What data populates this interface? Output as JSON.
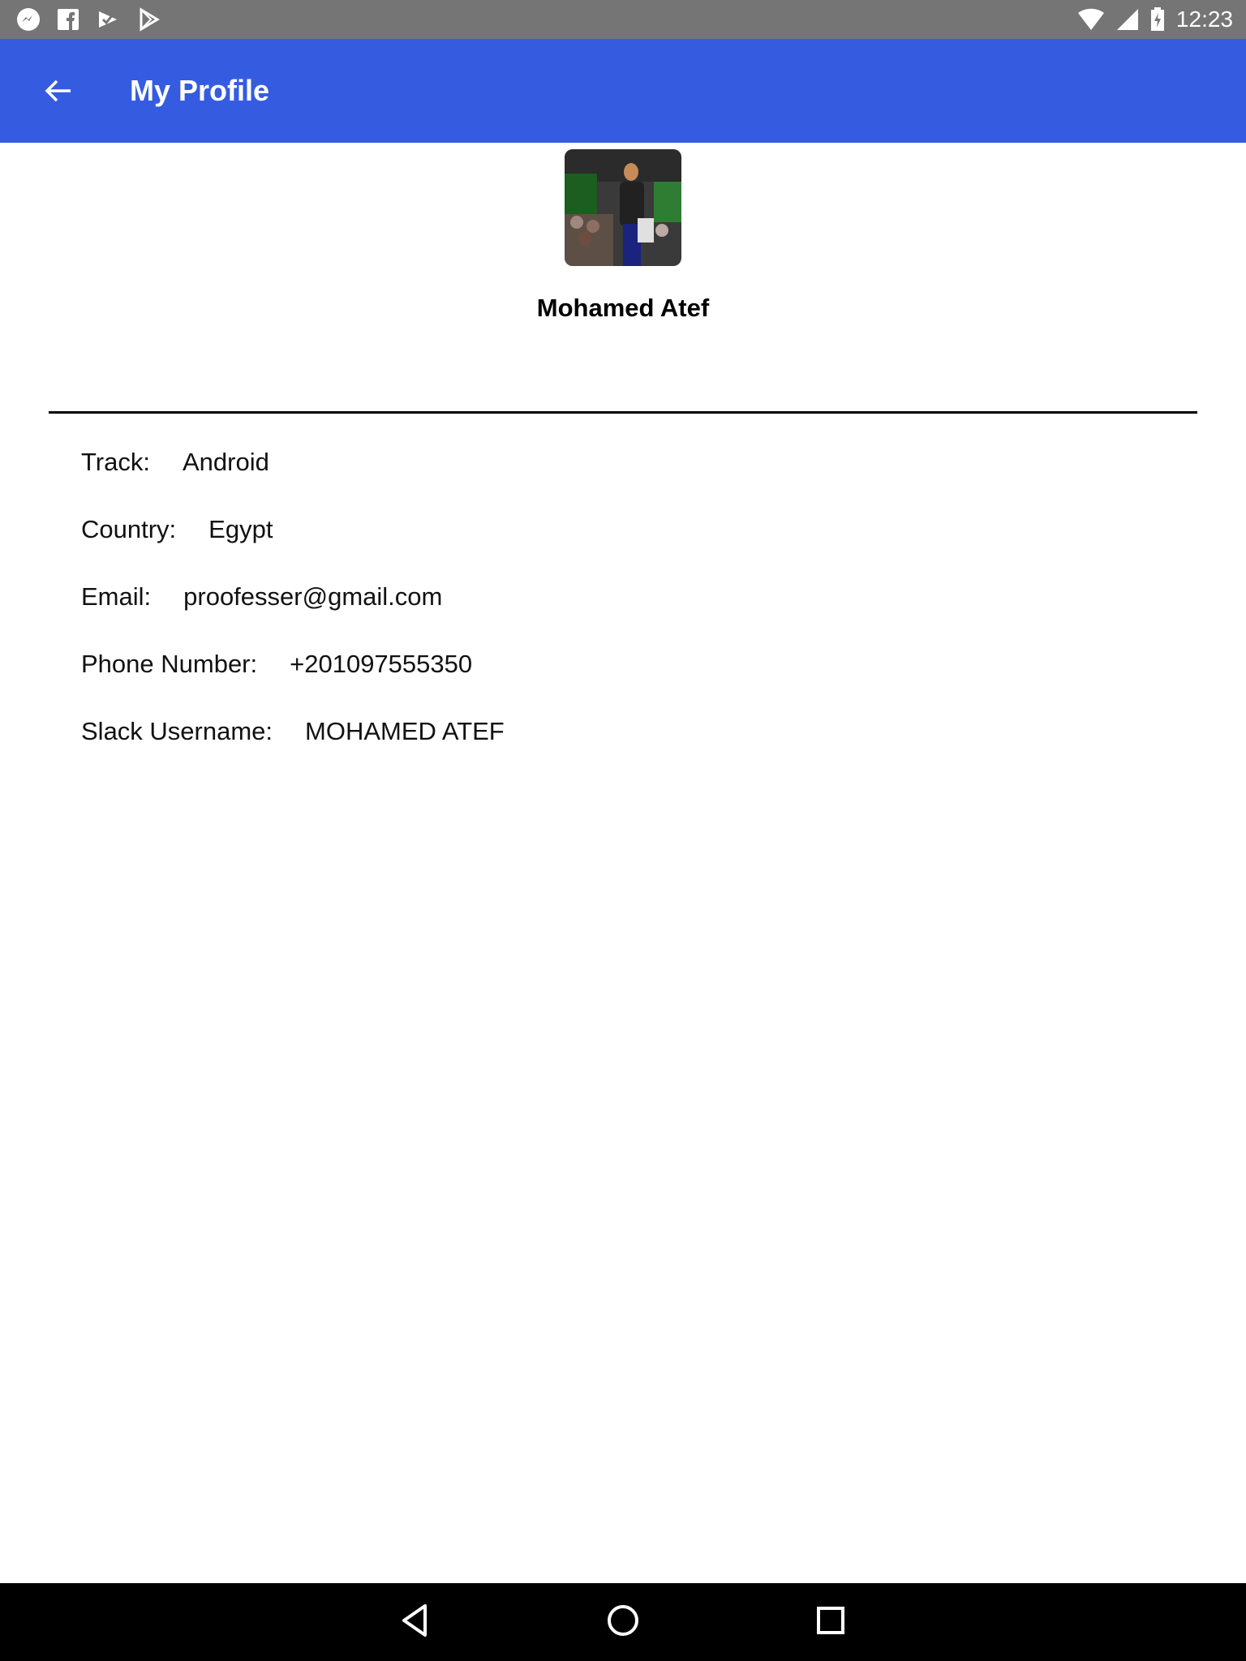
{
  "status_bar": {
    "time": "12:23",
    "left_icons": [
      "messenger-icon",
      "facebook-icon",
      "inbox-check-icon",
      "play-store-icon"
    ],
    "right_icons": [
      "wifi-icon",
      "cell-signal-icon",
      "battery-charging-icon"
    ]
  },
  "app_bar": {
    "title": "My Profile",
    "back_icon": "arrow-back-icon",
    "background": "#355ce0"
  },
  "profile": {
    "name": "Mohamed Atef",
    "avatar": "profile-photo"
  },
  "details": [
    {
      "label": "Track:",
      "value": "Android"
    },
    {
      "label": "Country:",
      "value": "Egypt"
    },
    {
      "label": "Email:",
      "value": "proofesser@gmail.com"
    },
    {
      "label": "Phone Number:",
      "value": "+201097555350"
    },
    {
      "label": "Slack Username:",
      "value": "MOHAMED ATEF"
    }
  ],
  "nav_bar": {
    "icons": [
      "nav-back-icon",
      "nav-home-icon",
      "nav-recents-icon"
    ]
  }
}
